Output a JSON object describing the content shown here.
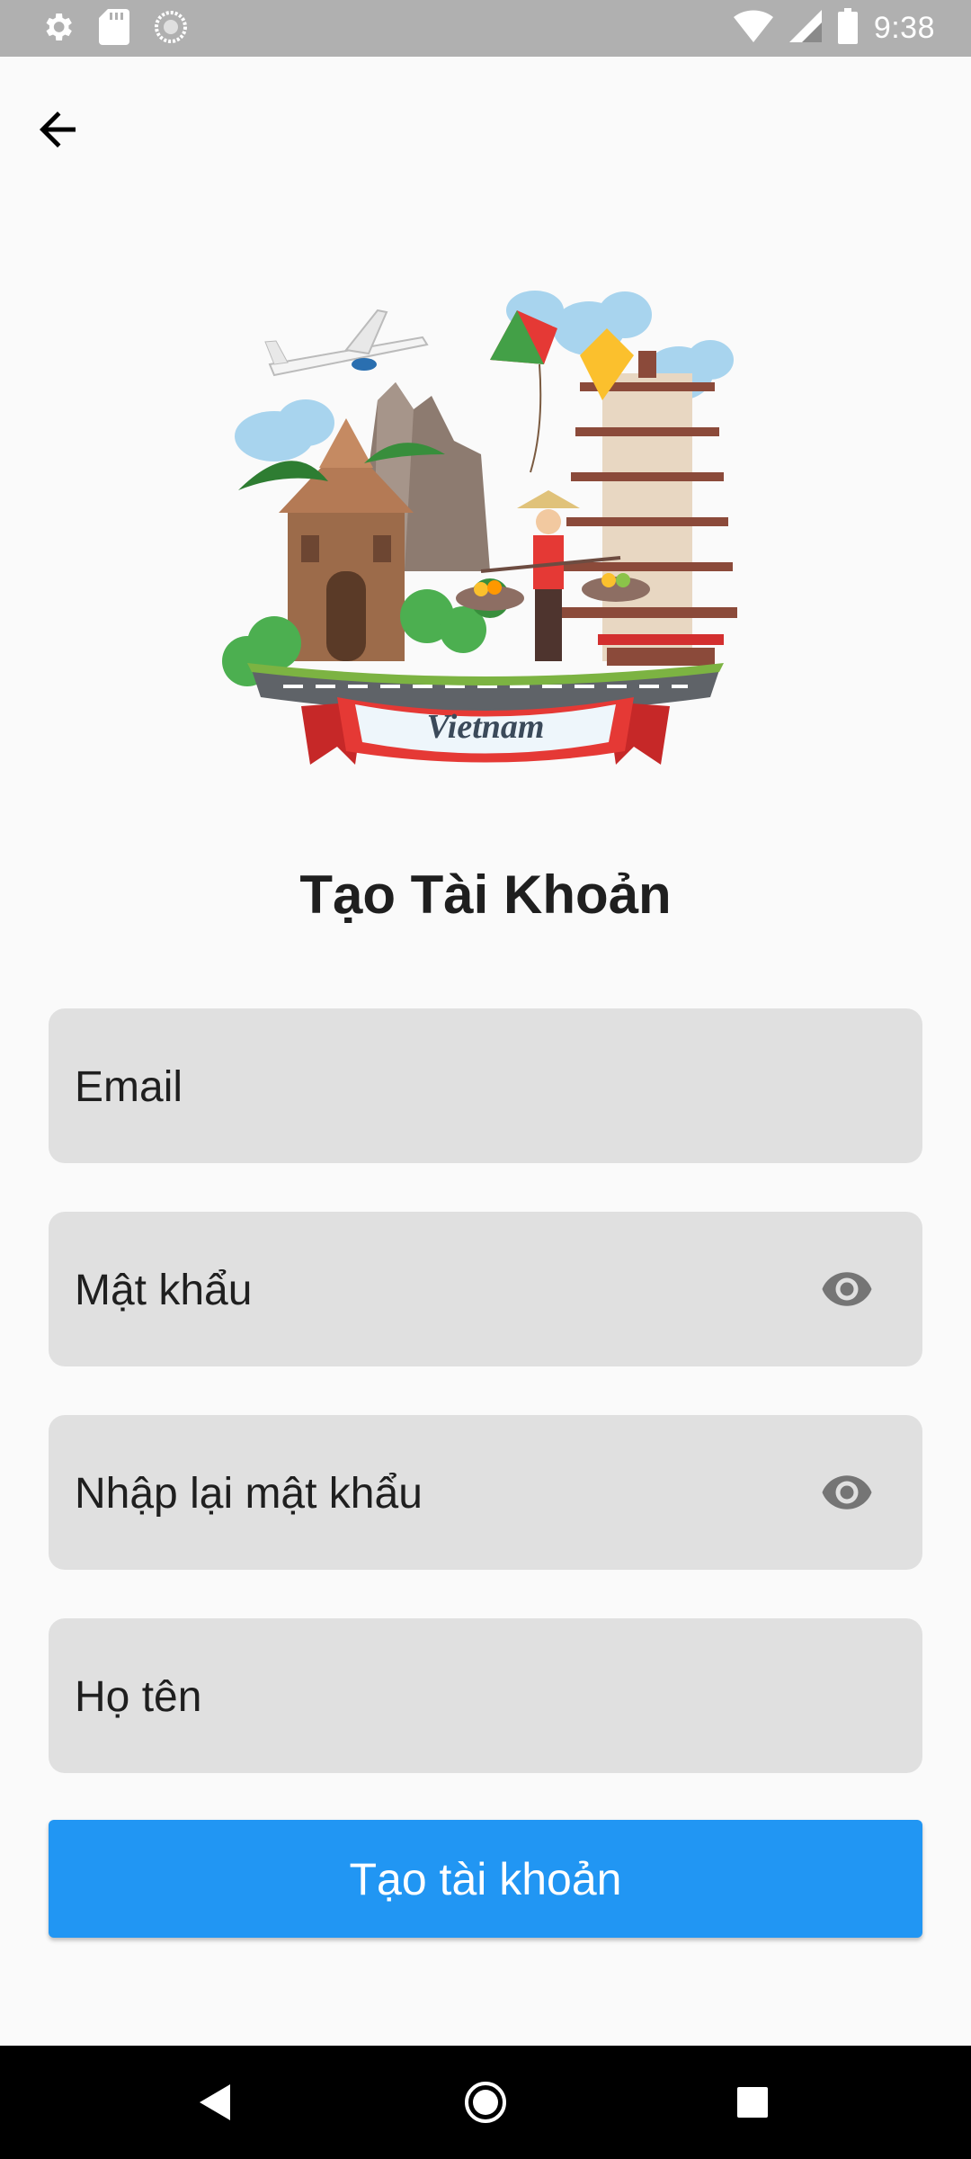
{
  "status_bar": {
    "time": "9:38",
    "left_icons": [
      "gear-icon",
      "sd-card-icon",
      "sync-icon"
    ],
    "right_icons": [
      "wifi-icon",
      "signal-icon",
      "battery-icon"
    ]
  },
  "header": {
    "back_icon": "arrow-back-icon"
  },
  "hero": {
    "banner_text": "Vietnam"
  },
  "title": "Tạo Tài Khoản",
  "form": {
    "email_placeholder": "Email",
    "password_placeholder": "Mật khẩu",
    "confirm_password_placeholder": "Nhập lại mật khẩu",
    "fullname_placeholder": "Họ tên",
    "toggle_icon": "eye-icon"
  },
  "submit_label": "Tạo tài khoản",
  "colors": {
    "accent": "#2196f3",
    "field_bg": "#e0e0e0",
    "status_bar": "#b0b0b0"
  },
  "nav_bar": {
    "icons": [
      "back-triangle-icon",
      "home-circle-icon",
      "recents-square-icon"
    ]
  }
}
